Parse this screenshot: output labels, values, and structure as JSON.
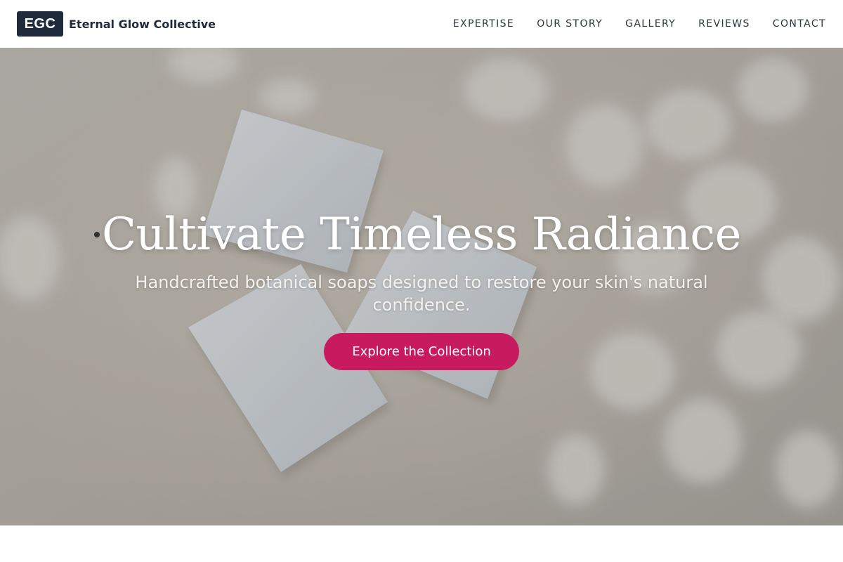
{
  "header": {
    "logo_mark": "EGC",
    "brand_name": "Eternal Glow Collective",
    "nav": [
      "EXPERTISE",
      "OUR STORY",
      "GALLERY",
      "REVIEWS",
      "CONTACT"
    ]
  },
  "hero": {
    "title": "Cultivate Timeless Radiance",
    "subtitle": "Handcrafted botanical soaps designed to restore your skin's natural confidence.",
    "cta_label": "Explore the Collection"
  },
  "colors": {
    "brand_dark": "#1f2a3d",
    "accent": "#c81a5f",
    "header_bg": "#ffffff"
  }
}
